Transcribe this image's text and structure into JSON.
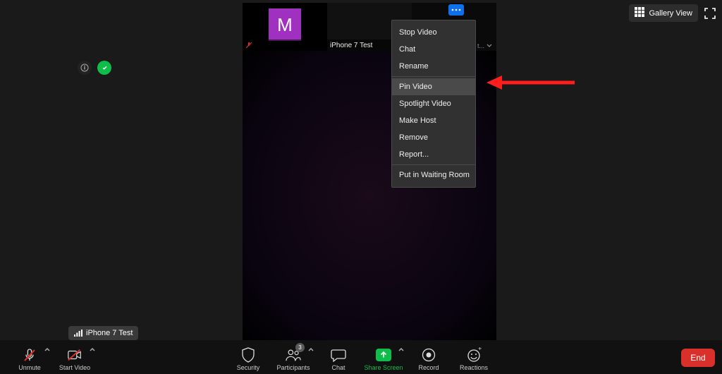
{
  "topright": {
    "gallery": "Gallery View"
  },
  "thumbs": [
    {
      "avatar_letter": "M",
      "label": ""
    },
    {
      "label": "iPhone 7 Test"
    },
    {
      "label": "Connecting t..."
    }
  ],
  "context_menu": {
    "groups": [
      [
        "Stop Video",
        "Chat",
        "Rename"
      ],
      [
        "Pin Video",
        "Spotlight Video",
        "Make Host",
        "Remove",
        "Report..."
      ],
      [
        "Put in Waiting Room"
      ]
    ],
    "highlighted": "Pin Video"
  },
  "tooltip": {
    "text": "iPhone 7 Test"
  },
  "toolbar": {
    "unmute": "Unmute",
    "start_video": "Start Video",
    "security": "Security",
    "participants": "Participants",
    "participants_count": "3",
    "chat": "Chat",
    "share": "Share Screen",
    "record": "Record",
    "reactions": "Reactions",
    "end": "End"
  }
}
